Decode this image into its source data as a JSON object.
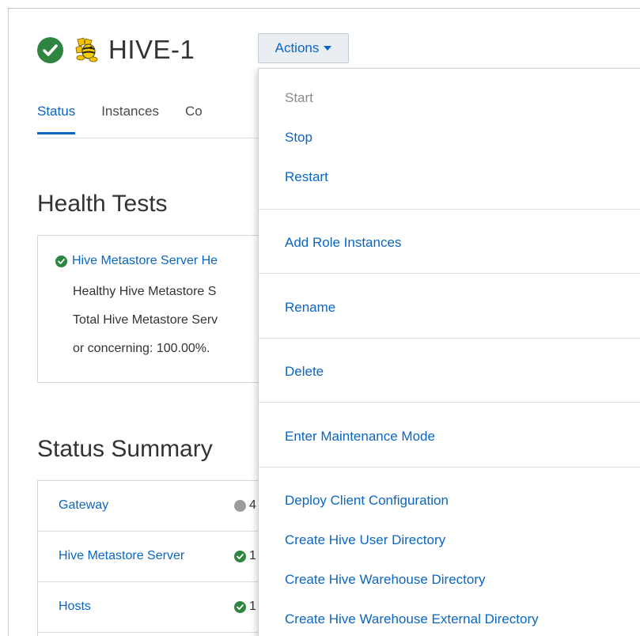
{
  "service": {
    "title": "HIVE-1",
    "status_icon": "check-circle-icon",
    "logo_icon": "hive-bee-logo-icon"
  },
  "actions_button": {
    "label": "Actions"
  },
  "tabs": [
    {
      "label": "Status",
      "active": true
    },
    {
      "label": "Instances",
      "active": false
    },
    {
      "label": "Co",
      "active": false
    }
  ],
  "health_tests": {
    "heading": "Health Tests",
    "item": {
      "title": "Hive Metastore Server He",
      "lines": [
        "Healthy Hive Metastore S",
        "Total Hive Metastore Serv",
        "or concerning: 100.00%."
      ]
    }
  },
  "status_summary": {
    "heading": "Status Summary",
    "rows": [
      {
        "name": "Gateway",
        "status": "grey",
        "count": "4"
      },
      {
        "name": "Hive Metastore Server",
        "status": "good",
        "count": "1"
      },
      {
        "name": "Hosts",
        "status": "good",
        "count": "1"
      }
    ]
  },
  "actions_menu": {
    "items": [
      {
        "label": "Start",
        "disabled": true
      },
      {
        "label": "Stop",
        "disabled": false
      },
      {
        "label": "Restart",
        "disabled": false
      },
      {
        "label": "Add Role Instances",
        "disabled": false
      },
      {
        "label": "Rename",
        "disabled": false
      },
      {
        "label": "Delete",
        "disabled": false
      },
      {
        "label": "Enter Maintenance Mode",
        "disabled": false
      },
      {
        "label": "Deploy Client Configuration",
        "disabled": false
      },
      {
        "label": "Create Hive User Directory",
        "disabled": false
      },
      {
        "label": "Create Hive Warehouse Directory",
        "disabled": false
      },
      {
        "label": "Create Hive Warehouse External Directory",
        "disabled": false
      }
    ]
  },
  "colors": {
    "link": "#0a66c2",
    "good": "#2e8540",
    "neutral": "#9b9b9b",
    "disabled_text": "#8a8a8a"
  }
}
